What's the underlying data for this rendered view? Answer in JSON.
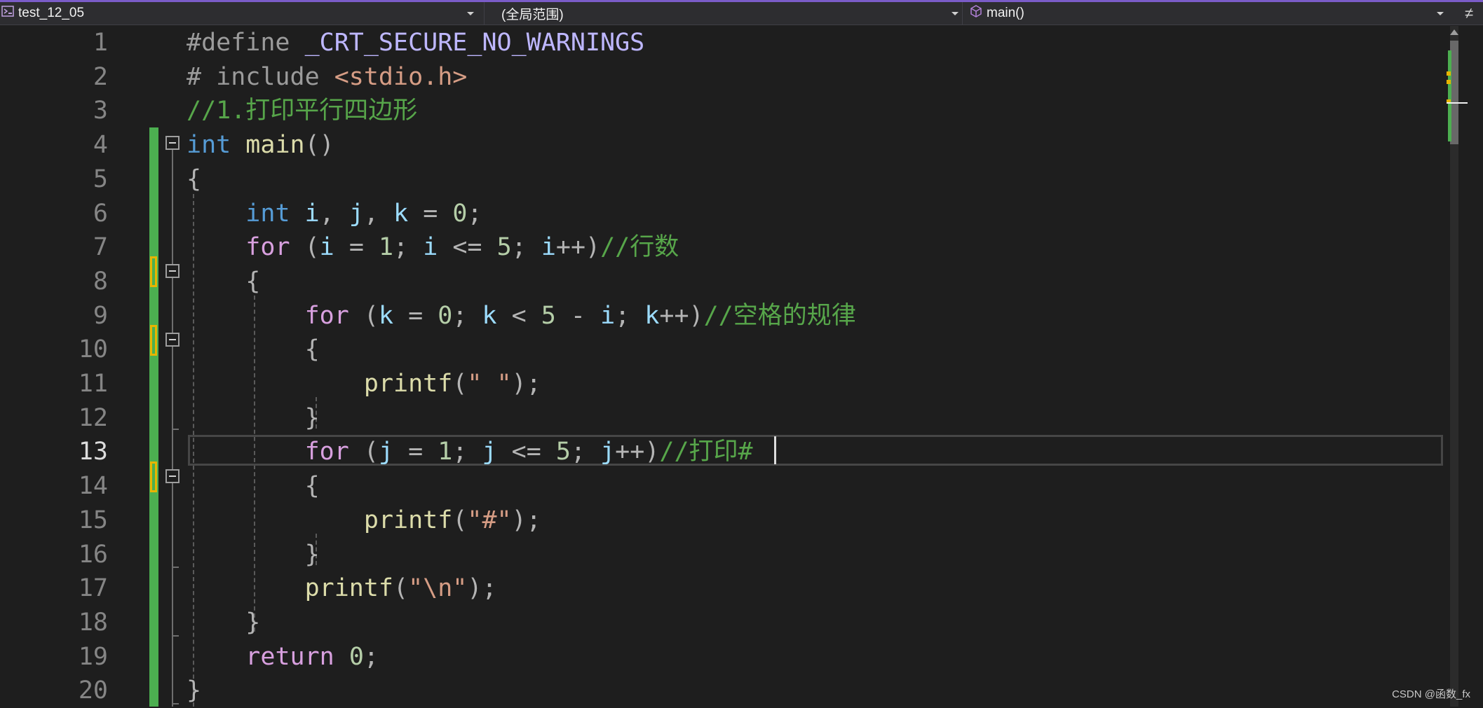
{
  "navbar": {
    "project": "test_12_05",
    "scope": "(全局范围)",
    "member": "main()",
    "project_icon": "project-icon",
    "member_icon": "cube-icon",
    "split_icon": "split-window-icon"
  },
  "line_numbers": [
    "1",
    "2",
    "3",
    "4",
    "5",
    "6",
    "7",
    "8",
    "9",
    "10",
    "11",
    "12",
    "13",
    "14",
    "15",
    "16",
    "17",
    "18",
    "19",
    "20"
  ],
  "active_line": "13",
  "code": {
    "l1": {
      "macro": "_CRT_SECURE_NO_WARNINGS",
      "directive": "#define "
    },
    "l2": {
      "directive": "# include ",
      "header": "<stdio.h>"
    },
    "l3": {
      "comment": "//1.打印平行四边形"
    },
    "l4": {
      "kw": "int",
      "fn": "main",
      "rest": "()"
    },
    "l5": {
      "text": "{"
    },
    "l6": {
      "kw": "int",
      "i": "i",
      "j": "j",
      "k": "k",
      "zero": "0"
    },
    "l7": {
      "kw": "for",
      "comment": "//行数"
    },
    "l8": {
      "text": "{"
    },
    "l9": {
      "kw": "for",
      "comment": "//空格的规律"
    },
    "l10": {
      "text": "{"
    },
    "l11": {
      "fn": "printf",
      "str": "\" \""
    },
    "l12": {
      "text": "}"
    },
    "l13": {
      "kw": "for",
      "comment": "//打印#"
    },
    "l14": {
      "text": "{"
    },
    "l15": {
      "fn": "printf",
      "str": "\"#\""
    },
    "l16": {
      "text": "}"
    },
    "l17": {
      "fn": "printf",
      "str": "\"\\n\""
    },
    "l18": {
      "text": "}"
    },
    "l19": {
      "kw": "return",
      "zero": "0"
    },
    "l20": {
      "text": "}"
    }
  },
  "watermark": "CSDN @函数_fx"
}
